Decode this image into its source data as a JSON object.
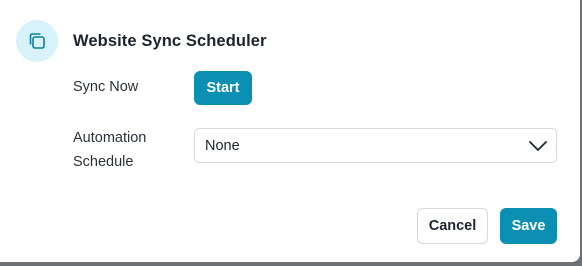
{
  "dialog": {
    "icon": "copy-icon",
    "title": "Website Sync Scheduler"
  },
  "form": {
    "sync_now_label": "Sync Now",
    "start_label": "Start",
    "automation_label_line1": "Automation",
    "automation_label_line2": "Schedule",
    "schedule_selected": "None"
  },
  "footer": {
    "cancel_label": "Cancel",
    "save_label": "Save"
  },
  "colors": {
    "accent": "#0b8fb3",
    "icon_bg": "#d7f3f9",
    "overlay": "#6f7073"
  }
}
